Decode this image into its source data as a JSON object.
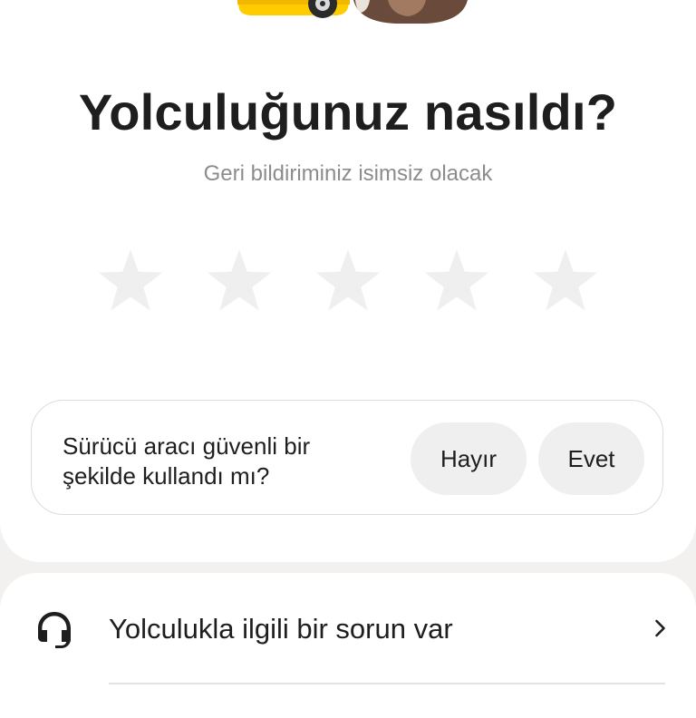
{
  "header": {
    "taxi_illustration": "yellow-taxi-illustration",
    "driver_avatar": "driver-photo-avatar"
  },
  "rating": {
    "title": "Yolculuğunuz nasıldı?",
    "subtitle": "Geri bildiriminiz isimsiz olacak",
    "stars_total": 5,
    "stars_selected": 0,
    "star_icon": "star-icon",
    "empty_star_color": "#efefef"
  },
  "safety_question": {
    "text": "Sürücü aracı güvenli bir şekilde kullandı mı?",
    "no_label": "Hayır",
    "yes_label": "Evet"
  },
  "support": {
    "icon": "headset-icon",
    "label": "Yolculukla ilgili bir sorun var",
    "chevron_icon": "chevron-right-icon"
  },
  "colors": {
    "background": "#f2f1f0",
    "card": "#ffffff",
    "text_primary": "#1e1e1e",
    "text_secondary": "#8c8c8c",
    "pill": "#efefef",
    "taxi_yellow": "#ffcc00"
  }
}
